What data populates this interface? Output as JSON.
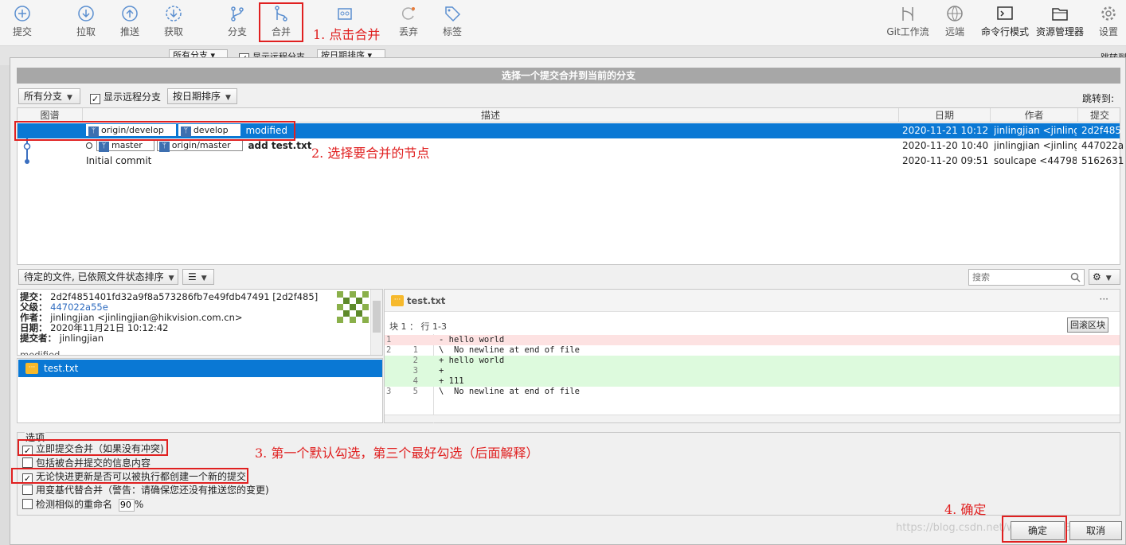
{
  "toolbar": {
    "left": [
      {
        "label": "提交",
        "icon": "commit-icon"
      },
      {
        "label": "拉取",
        "icon": "pull-icon"
      },
      {
        "label": "推送",
        "icon": "push-icon"
      },
      {
        "label": "获取",
        "icon": "fetch-icon"
      },
      {
        "label": "分支",
        "icon": "branch-icon"
      },
      {
        "label": "合并",
        "icon": "merge-icon"
      },
      {
        "label": "丢弃",
        "icon": "discard-icon"
      },
      {
        "label": "标签",
        "icon": "tag-icon"
      }
    ],
    "right": [
      {
        "label": "Git工作流",
        "icon": "git-flow-icon"
      },
      {
        "label": "远端",
        "icon": "remote-icon"
      },
      {
        "label": "命令行模式",
        "icon": "terminal-icon"
      },
      {
        "label": "资源管理器",
        "icon": "explorer-icon"
      },
      {
        "label": "设置",
        "icon": "settings-icon"
      }
    ]
  },
  "background_bar": {
    "branch_filter": "所有分支",
    "show_remote": "显示远程分支",
    "sort": "按日期排序",
    "jump": "跳转到"
  },
  "dialog": {
    "title": "选择一个提交合并到当前的分支",
    "branch_filter": "所有分支",
    "show_remote_label": "显示远程分支",
    "show_remote_checked": true,
    "sort": "按日期排序",
    "jump_label": "跳转到:",
    "columns": {
      "graph": "图谱",
      "desc": "描述",
      "date": "日期",
      "author": "作者",
      "commit": "提交"
    },
    "rows": [
      {
        "tags": [
          "origin/develop",
          "develop"
        ],
        "message": "modified",
        "date": "2020-11-21 10:12",
        "author": "jinlingjian <jinling",
        "commit": "2d2f485",
        "selected": true
      },
      {
        "tags": [
          "master",
          "origin/master"
        ],
        "message": "add test.txt",
        "date": "2020-11-20 10:40",
        "author": "jinlingjian <jinling",
        "commit": "447022a",
        "selected": false
      },
      {
        "tags": [],
        "message": "Initial commit",
        "date": "2020-11-20 09:51",
        "author": "soulcape <44798",
        "commit": "5162631",
        "selected": false
      }
    ],
    "pending_files": "待定的文件, 已依照文件状态排序",
    "search_placeholder": "搜索",
    "commit_info": {
      "commit_label": "提交：",
      "commit": "2d2f4851401fd32a9f8a573286fb7e49fdb47491 [2d2f485]",
      "parent_label": "父级：",
      "parent": "447022a55e",
      "author_label": "作者：",
      "author": "jinlingjian <jinlingjian@hikvision.com.cn>",
      "date_label": "日期：",
      "date": "2020年11月21日 10:12:42",
      "committer_label": "提交者：",
      "committer": "jinlingjian",
      "message": "modified"
    },
    "file": "test.txt",
    "diff": {
      "filename": "test.txt",
      "hunk": "块 1 ： 行 1-3",
      "revert_button": "回滚区块",
      "lines": [
        {
          "old": "1",
          "new": "",
          "text": "- hello world",
          "type": "del"
        },
        {
          "old": "2",
          "new": "1",
          "text": "\\  No newline at end of file",
          "type": "ctx"
        },
        {
          "old": "",
          "new": "2",
          "text": "+ hello world",
          "type": "add"
        },
        {
          "old": "",
          "new": "3",
          "text": "+",
          "type": "add"
        },
        {
          "old": "",
          "new": "4",
          "text": "+ 111",
          "type": "add"
        },
        {
          "old": "3",
          "new": "5",
          "text": "\\  No newline at end of file",
          "type": "ctx"
        }
      ]
    },
    "options_title": "选项",
    "options": [
      {
        "label": "立即提交合并（如果没有冲突)",
        "checked": true
      },
      {
        "label": "包括被合并提交的信息内容",
        "checked": false
      },
      {
        "label": "无论快进更新是否可以被执行都创建一个新的提交",
        "checked": true
      },
      {
        "label": "用变基代替合并（警告：请确保您还没有推送您的变更)",
        "checked": false
      },
      {
        "label": "检测相似的重命名",
        "checked": false
      }
    ],
    "rename_value": "90",
    "rename_unit": "%",
    "ok": "确定",
    "cancel": "取消",
    "watermark": "https://blog.csdn.net/weixin_4263936"
  },
  "annotations": {
    "a1": "1. 点击合并",
    "a2": "2. 选择要合并的节点",
    "a3": "3. 第一个默认勾选，第三个最好勾选（后面解释）",
    "a4": "4. 确定"
  },
  "colors": {
    "selection": "#0a78d4",
    "annotation": "#e02020",
    "diff_add": "#ddfadd",
    "diff_del": "#fde2e2"
  }
}
